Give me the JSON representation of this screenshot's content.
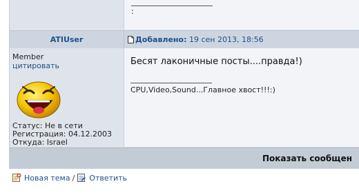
{
  "previous_post": {
    "signature_text": ":"
  },
  "post": {
    "author": "ATIUser",
    "added_label": "Добавлено:",
    "date": "19 сен 2013, 18:56",
    "rank": "Member",
    "quote_link": "цитировать",
    "status": "Статус: Не в сети",
    "registration": "Регистрация: 04.12.2003",
    "location": "Откуда: Israel",
    "body": "Бесят лаконичные посты....правда!)",
    "signature": "CPU,Video,Sound...Главное хвост!!!:)"
  },
  "bar": {
    "show_messages_label": "Показать сообщен"
  },
  "footer": {
    "new_topic_label": "Новая тема",
    "separator": "/",
    "reply_label": "Ответить"
  },
  "icons": {
    "post": "document-icon",
    "avatar": "laughing-smiley-icon",
    "new_topic": "new-topic-icon",
    "reply": "reply-icon"
  }
}
